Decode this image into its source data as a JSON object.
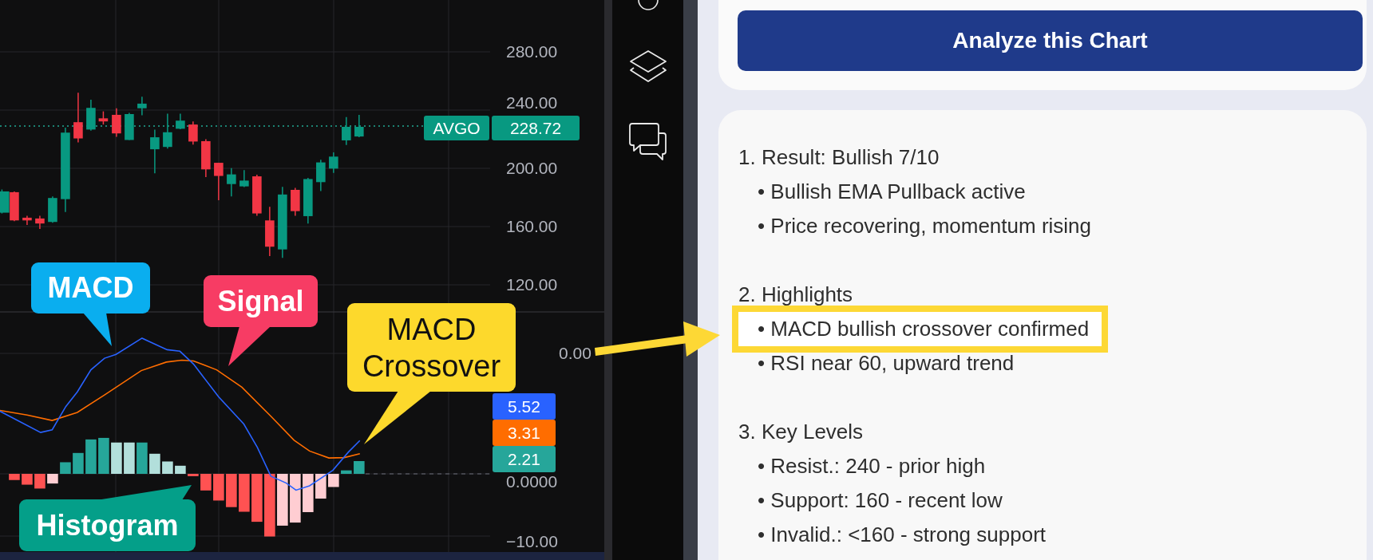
{
  "chart": {
    "price_axis": [
      "280.00",
      "240.00",
      "200.00",
      "160.00",
      "120.00"
    ],
    "symbol_tag": {
      "symbol": "AVGO",
      "price": "228.72"
    },
    "indicator_axis": [
      "0.00",
      "0.0000",
      "−10.00"
    ],
    "indicator_tags": [
      {
        "value": "5.52",
        "color": "#2962ff"
      },
      {
        "value": "3.31",
        "color": "#ff6d00"
      },
      {
        "value": "2.21",
        "color": "#26a69a"
      }
    ],
    "callouts": [
      {
        "kind": "macd",
        "text": "MACD",
        "color": "#0aaeef"
      },
      {
        "kind": "signal",
        "text": "Signal",
        "color": "#f73c64"
      },
      {
        "kind": "crossover",
        "text": "MACD Crossover",
        "color": "#fdd92c"
      },
      {
        "kind": "histogram",
        "text": "Histogram",
        "color": "#049f89"
      }
    ]
  },
  "analyze_button": "Analyze this Chart",
  "analysis": [
    {
      "heading": "1. Result: Bullish 7/10",
      "items": [
        {
          "text": "• Bullish EMA Pullback active",
          "highlighted": false
        },
        {
          "text": "• Price recovering, momentum rising",
          "highlighted": false
        }
      ]
    },
    {
      "heading": "2. Highlights",
      "items": [
        {
          "text": "• MACD bullish crossover confirmed",
          "highlighted": true
        },
        {
          "text": "• RSI near 60, upward trend",
          "highlighted": false
        }
      ]
    },
    {
      "heading": "3. Key Levels",
      "items": [
        {
          "text": "• Resist.: 240 - prior high",
          "highlighted": false
        },
        {
          "text": "• Support: 160 - recent low",
          "highlighted": false
        },
        {
          "text": "• Invalid.: <160 - strong support",
          "highlighted": false
        }
      ]
    }
  ]
}
